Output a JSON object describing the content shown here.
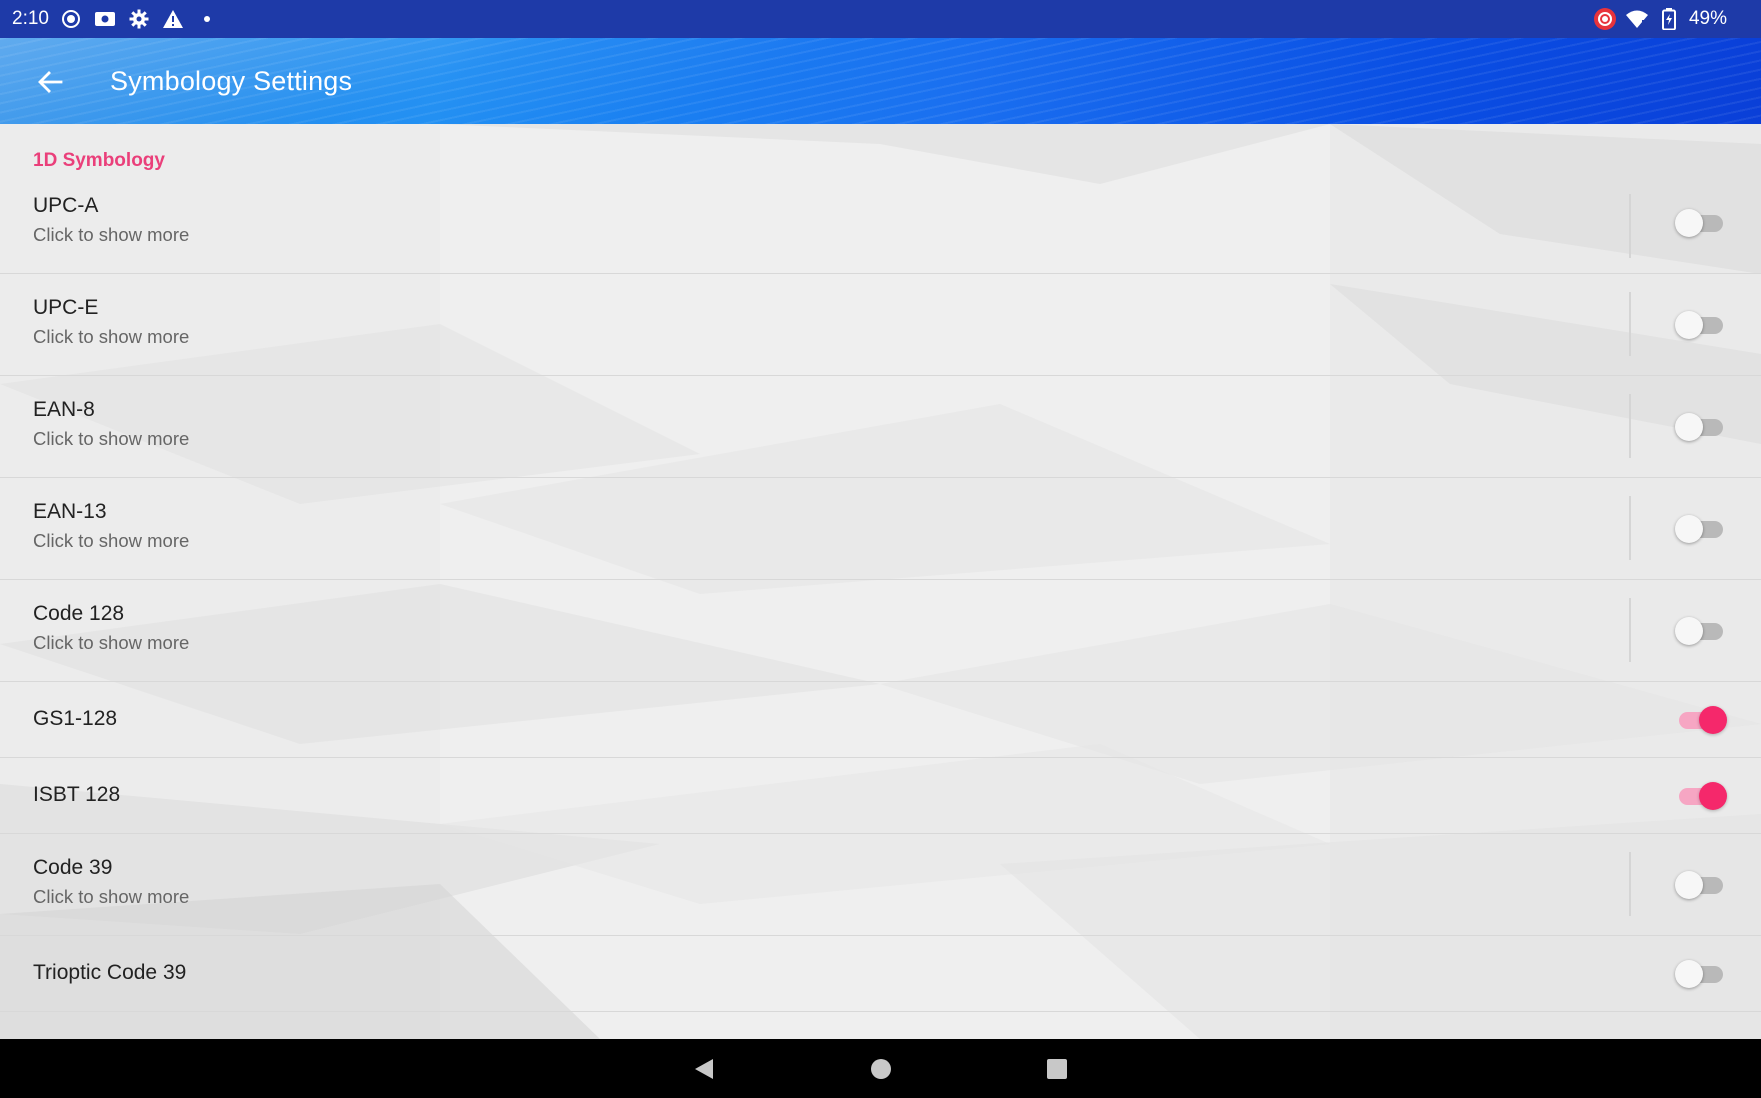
{
  "status_bar": {
    "time": "2:10",
    "battery_text": "49%",
    "left_icons": [
      "record-icon",
      "screen-cast-icon",
      "gear-icon",
      "warning-icon",
      "dot-icon"
    ],
    "right_icons": [
      "screen-record-icon",
      "wifi-icon",
      "battery-icon"
    ]
  },
  "app_bar": {
    "title": "Symbology Settings",
    "back_icon": "arrow-left-icon"
  },
  "content": {
    "category_title": "1D Symbology",
    "items": [
      {
        "title": "UPC-A",
        "summary": "Click to show more",
        "enabled": false
      },
      {
        "title": "UPC-E",
        "summary": "Click to show more",
        "enabled": false
      },
      {
        "title": "EAN-8",
        "summary": "Click to show more",
        "enabled": false
      },
      {
        "title": "EAN-13",
        "summary": "Click to show more",
        "enabled": false
      },
      {
        "title": "Code 128",
        "summary": "Click to show more",
        "enabled": false
      },
      {
        "title": "GS1-128",
        "summary": "",
        "enabled": true
      },
      {
        "title": "ISBT 128",
        "summary": "",
        "enabled": true
      },
      {
        "title": "Code 39",
        "summary": "Click to show more",
        "enabled": false
      },
      {
        "title": "Trioptic Code 39",
        "summary": "",
        "enabled": false
      }
    ]
  },
  "nav_bar": {
    "icons": [
      "back-triangle-icon",
      "home-circle-icon",
      "recents-square-icon"
    ]
  },
  "colors": {
    "accent": "#ea3f7a",
    "switch_on": "#f5286b",
    "status_bar": "#1e3aa8",
    "app_bar": "#1a6ff0"
  }
}
